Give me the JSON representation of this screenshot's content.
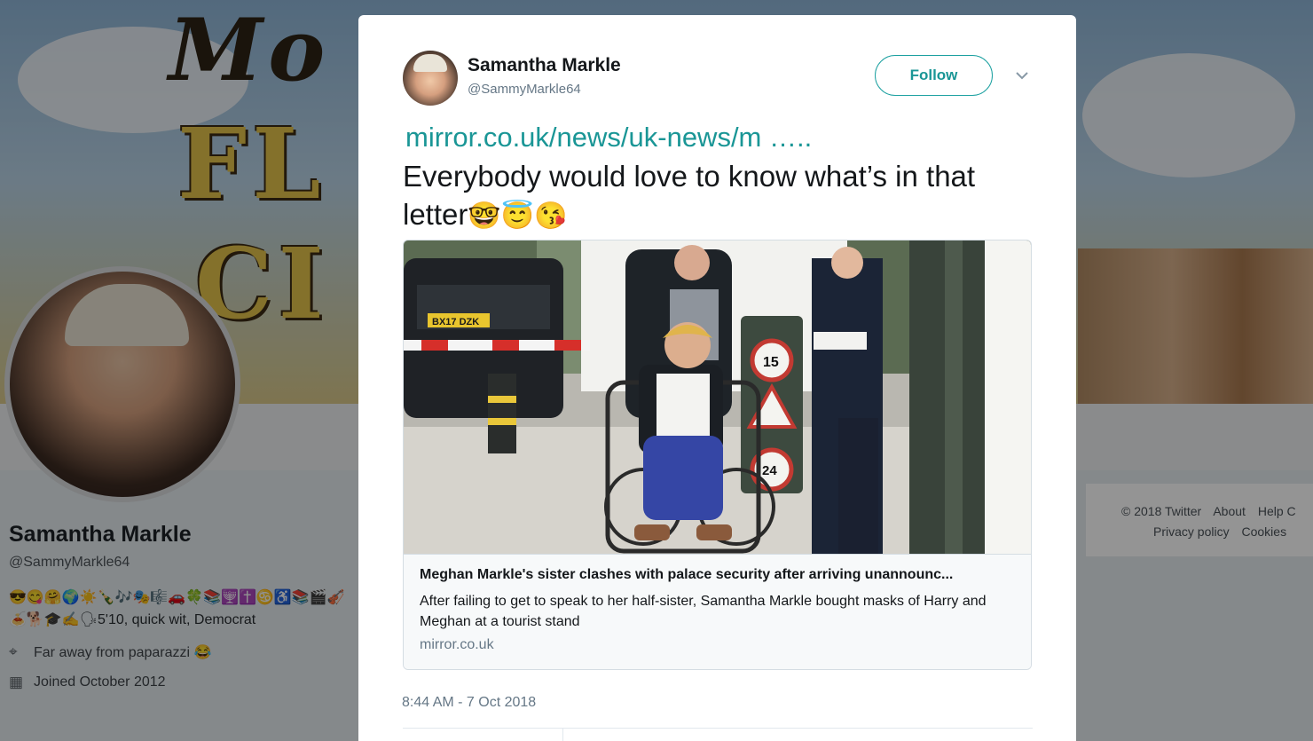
{
  "background": {
    "profile": {
      "name": "Samantha Markle",
      "handle": "@SammyMarkle64",
      "bio": "😎😋🤗🌍☀️🍾🎶🎭🎼🚗🍀📚🕎✝️♋♿📚🎬🎻🍝🐕🎓✍️🗣5'10, quick wit, Democrat",
      "location": "Far away from paparazzi 😂",
      "joined": "Joined October 2012"
    },
    "footer": {
      "copyright": "© 2018 Twitter",
      "about": "About",
      "help": "Help C",
      "privacy": "Privacy policy",
      "cookies": "Cookies"
    }
  },
  "tweet": {
    "author_name": "Samantha Markle",
    "author_handle": "@SammyMarkle64",
    "follow_label": "Follow",
    "link_text": "mirror.co.uk/news/uk-news/m …..",
    "text": "Everybody would love to know what’s in that letter",
    "emojis": "🤓😇😘",
    "card": {
      "title": "Meghan Markle's sister clashes with palace security after arriving unannounc...",
      "description": "After failing to get to speak to her half-sister, Samantha Markle bought masks of Harry and Meghan at a tourist stand",
      "domain": "mirror.co.uk",
      "plate": "BX17 DZK",
      "sign_speed": "15",
      "sign_number": "24"
    },
    "timestamp": "8:44 AM - 7 Oct 2018"
  },
  "colors": {
    "accent": "#1a9696",
    "text": "#14171a",
    "muted": "#657786"
  }
}
